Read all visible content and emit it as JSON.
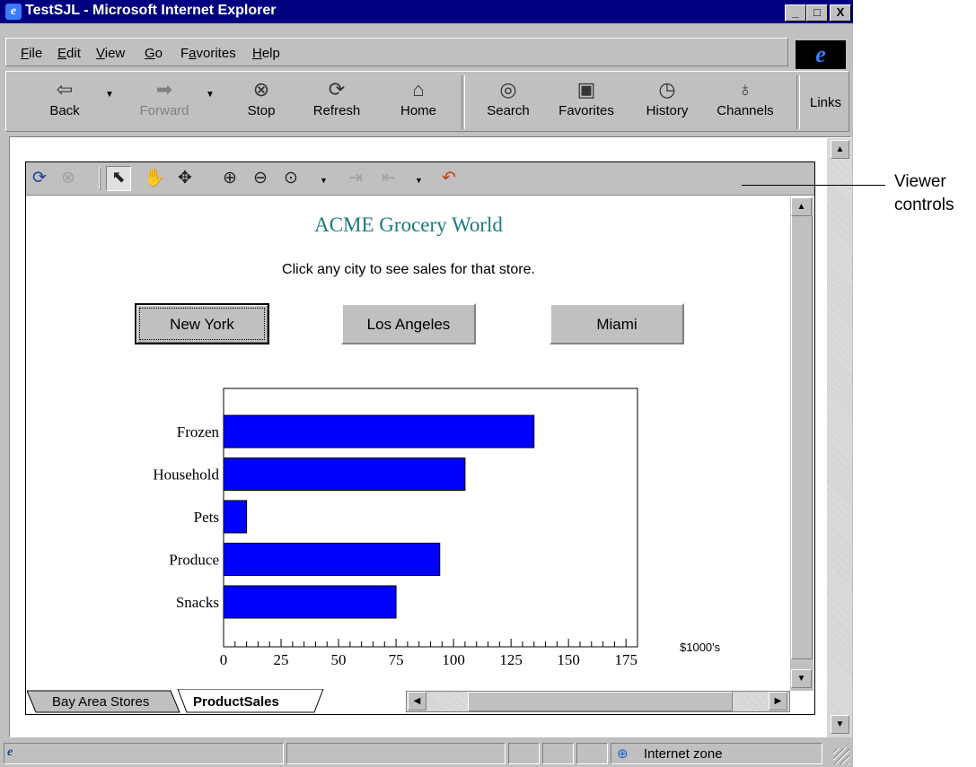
{
  "window": {
    "title": "TestSJL - Microsoft Internet Explorer",
    "minimize": "_",
    "maximize": "□",
    "close": "X"
  },
  "menu": [
    {
      "label": "File",
      "u": "F",
      "rest": "ile"
    },
    {
      "label": "Edit",
      "u": "E",
      "rest": "dit"
    },
    {
      "label": "View",
      "u": "V",
      "rest": "iew"
    },
    {
      "label": "Go",
      "u": "G",
      "rest": "o"
    },
    {
      "label": "Favorites",
      "pre": "F",
      "u": "a",
      "rest": "vorites"
    },
    {
      "label": "Help",
      "u": "H",
      "rest": "elp"
    }
  ],
  "ie_logo": "e",
  "toolbar": {
    "back": "Back",
    "forward": "Forward",
    "stop": "Stop",
    "refresh": "Refresh",
    "home": "Home",
    "search": "Search",
    "favorites": "Favorites",
    "history": "History",
    "channels": "Channels",
    "links": "Links"
  },
  "icons": {
    "back": "back-arrow-icon",
    "forward": "forward-arrow-icon",
    "stop": "stop-icon",
    "refresh": "refresh-icon",
    "home": "home-icon",
    "search": "search-icon",
    "favorites": "favorites-icon",
    "history": "history-icon",
    "channels": "channels-icon"
  },
  "annotation": {
    "line1": "Viewer",
    "line2": "controls"
  },
  "report": {
    "title": "ACME Grocery World",
    "subtitle": "Click any city to see sales for that store.",
    "cities": [
      "New York",
      "Los Angeles",
      "Miami"
    ],
    "units": "$1000's",
    "title_color": "#1a7a7a",
    "bar_color": "#0000ff"
  },
  "chart_data": {
    "type": "bar",
    "orientation": "horizontal",
    "categories": [
      "Frozen",
      "Household",
      "Pets",
      "Produce",
      "Snacks"
    ],
    "values": [
      135,
      105,
      10,
      94,
      75
    ],
    "xticks": [
      "0",
      "25",
      "50",
      "75",
      "100",
      "125",
      "150",
      "175"
    ],
    "xlim": [
      0,
      180
    ],
    "xlabel": "$1000's",
    "grid": false
  },
  "tabs": {
    "tab1": "Bay Area Stores",
    "tab2": "ProductSales"
  },
  "status": {
    "zone": "Internet zone"
  }
}
